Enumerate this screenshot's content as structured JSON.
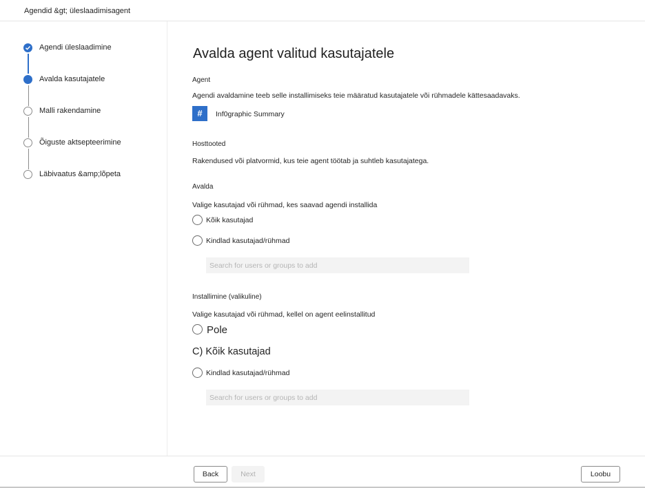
{
  "breadcrumb": "Agendid &gt; üleslaadimisagent",
  "steps": [
    {
      "label": "Agendi üleslaadimine",
      "state": "done"
    },
    {
      "label": "Avalda kasutajatele",
      "state": "current"
    },
    {
      "label": "Malli rakendamine",
      "state": "todo"
    },
    {
      "label": "Õiguste aktsepteerimine",
      "state": "todo"
    },
    {
      "label": "Läbivaatus &amp;lõpeta",
      "state": "todo"
    }
  ],
  "main": {
    "title": "Avalda agent valitud kasutajatele",
    "agent": {
      "section": "Agent",
      "description": "Agendi avaldamine teeb selle installimiseks teie määratud kasutajatele või rühmadele kättesaadavaks.",
      "icon": "#",
      "name": "Inf0graphic Summary"
    },
    "hosts": {
      "section": "Hosttooted",
      "description": "Rakendused või platvormid, kus teie agent töötab ja suhtleb kasutajatega."
    },
    "publish": {
      "section": "Avalda",
      "description": "Valige kasutajad või rühmad, kes saavad agendi installida",
      "option_all": "Kõik kasutajad",
      "option_specific": "Kindlad kasutajad/rühmad",
      "search_placeholder": "Search for users or groups to add"
    },
    "install": {
      "section": "Installimine (valikuline)",
      "description": "Valige kasutajad või rühmad, kellel on agent eelinstallitud",
      "option_none": "Pole",
      "option_all": "C) Kõik kasutajad",
      "option_specific": "Kindlad kasutajad/rühmad",
      "search_placeholder": "Search for users or groups to add"
    }
  },
  "footer": {
    "back_label": "Back",
    "next_label": "Next",
    "cancel_label": "Loobu"
  },
  "colors": {
    "accent": "#2e6fc9"
  }
}
